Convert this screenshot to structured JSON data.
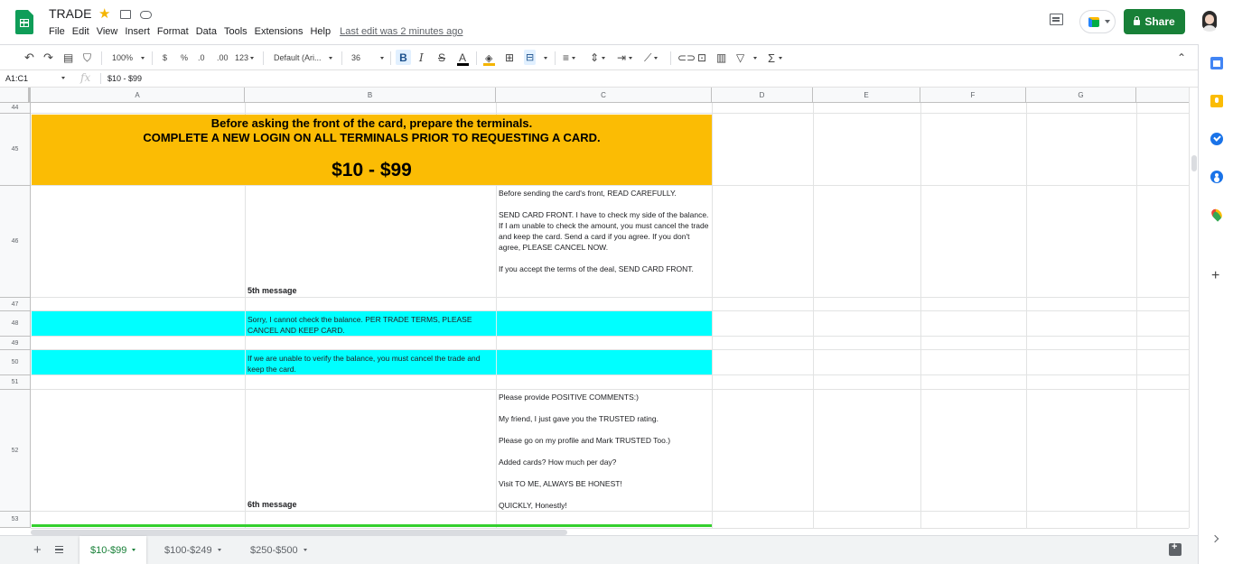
{
  "document": {
    "title": "TRADE",
    "last_edit": "Last edit was 2 minutes ago"
  },
  "menu": [
    "File",
    "Edit",
    "View",
    "Insert",
    "Format",
    "Data",
    "Tools",
    "Extensions",
    "Help"
  ],
  "header": {
    "share_label": "Share"
  },
  "toolbar": {
    "zoom": "100%",
    "currency": "$",
    "percent": "%",
    "decrease_decimal": ".0",
    "increase_decimal": ".00",
    "more_formats": "123",
    "font": "Default (Ari...",
    "font_size": "36",
    "bold": "B",
    "italic": "I",
    "strikethrough": "S",
    "text_color": "A"
  },
  "formula_bar": {
    "name_box": "A1:C1",
    "fx": "fx",
    "value": "$10 - $99"
  },
  "columns": [
    "A",
    "B",
    "C",
    "D",
    "E",
    "F",
    "G"
  ],
  "rows": [
    "44",
    "45",
    "46",
    "47",
    "48",
    "49",
    "50",
    "51",
    "52",
    "53"
  ],
  "cells": {
    "r45_line1": "Before asking the front of the card, prepare the terminals.",
    "r45_line2": "COMPLETE A NEW LOGIN ON ALL TERMINALS PRIOR TO REQUESTING A CARD.",
    "r45_price": "$10 - $99",
    "r46_b": "5th message",
    "r46_c": "Before sending the card's front, READ CAREFULLY.\n\nSEND CARD FRONT. I have to check my side of the balance. If I am unable to check the amount, you must cancel the trade and keep the card. Send a card if you agree. If you don't agree, PLEASE CANCEL NOW.\n\nIf you accept the terms of the deal, SEND CARD FRONT.",
    "r48_b": "Sorry, I cannot check the balance. PER TRADE TERMS, PLEASE CANCEL AND KEEP CARD.",
    "r50_b": "If we are unable to verify the balance, you must cancel the trade and keep the card.",
    "r52_b": "6th message",
    "r52_c": "Please provide POSITIVE COMMENTS:)\n\nMy friend, I just gave you the TRUSTED rating.\n\nPlease go on my profile and Mark TRUSTED Too.)\n\nAdded cards? How much per day?\n\nVisit TO ME, ALWAYS BE HONEST!\n\nQUICKLY, Honestly!"
  },
  "sheets": [
    {
      "label": "$10-$99",
      "active": true
    },
    {
      "label": "$100-$249",
      "active": false
    },
    {
      "label": "$250-$500",
      "active": false
    }
  ],
  "colors": {
    "header_orange": "#fbbc04",
    "highlight_cyan": "#00ffff",
    "share_green": "#188038",
    "border_green": "#34d02e"
  }
}
